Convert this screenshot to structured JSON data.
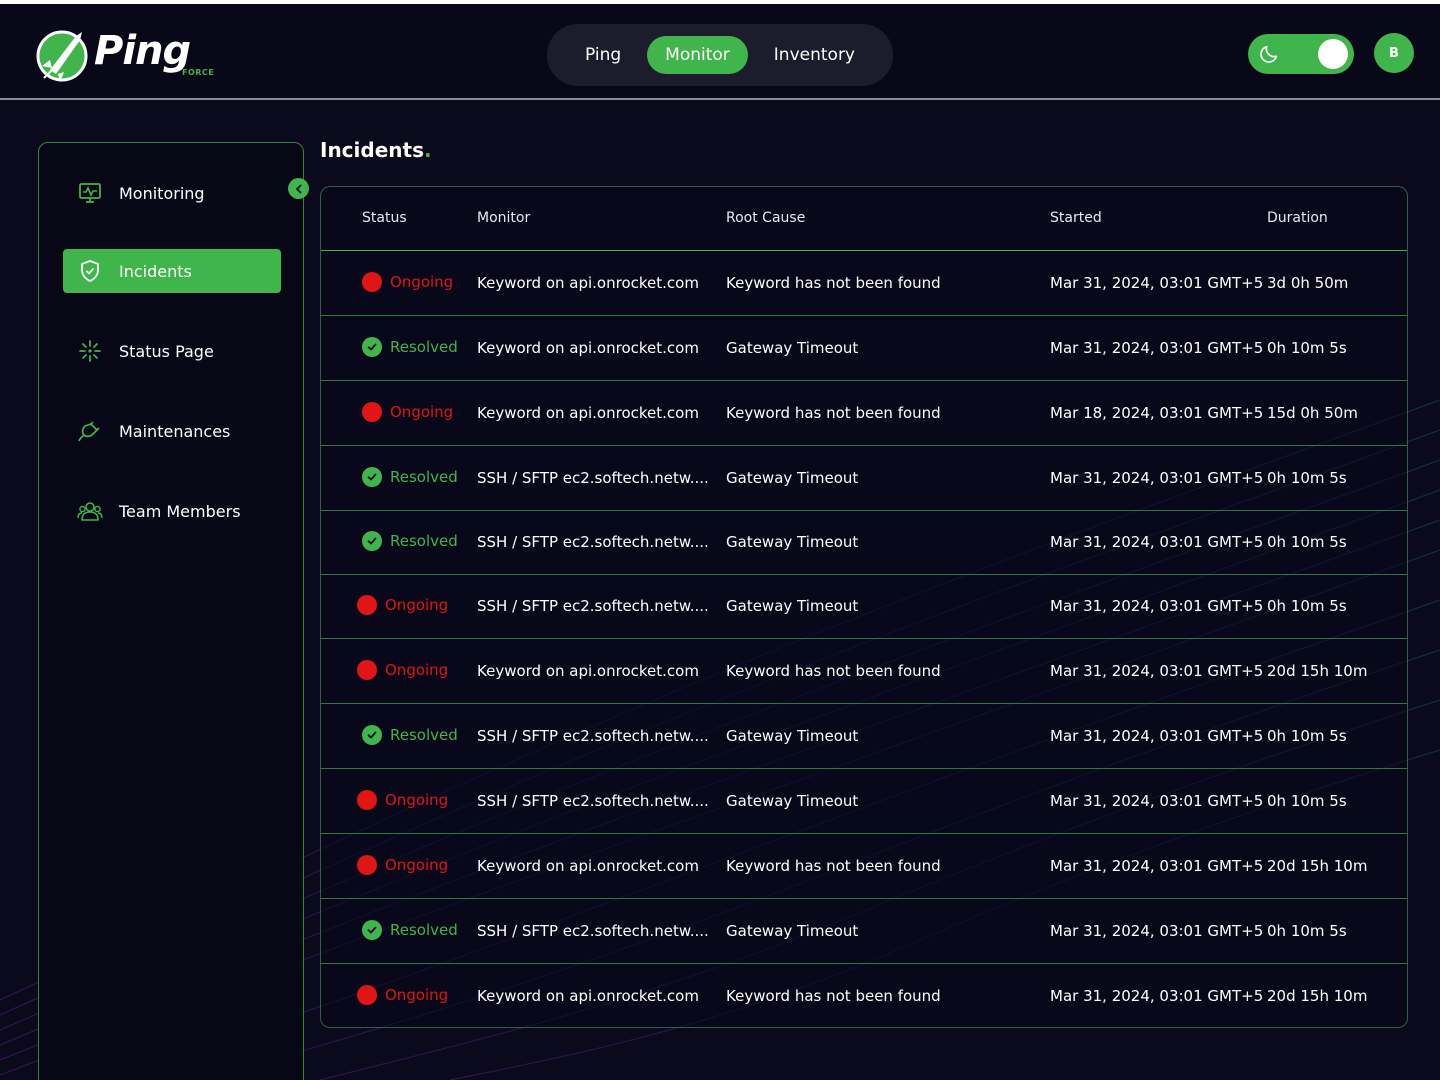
{
  "brand": {
    "name": "Ping",
    "sub": "FORCE"
  },
  "nav": {
    "items": [
      "Ping",
      "Monitor",
      "Inventory"
    ],
    "active": "Monitor"
  },
  "theme_toggle": {
    "icon": "moon-icon",
    "state": "dark"
  },
  "avatar": {
    "initial": "B"
  },
  "sidebar": {
    "items": [
      {
        "label": "Monitoring",
        "icon": "monitor-icon"
      },
      {
        "label": "Incidents",
        "icon": "shield-icon",
        "active": true
      },
      {
        "label": "Status Page",
        "icon": "sparkle-icon"
      },
      {
        "label": "Maintenances",
        "icon": "plug-icon"
      },
      {
        "label": "Team Members",
        "icon": "team-icon"
      }
    ]
  },
  "colors": {
    "accent": "#3fb54b",
    "danger": "#e01515",
    "background": "#0a0a1c"
  },
  "page": {
    "title": "Incidents",
    "title_dot": "."
  },
  "table": {
    "headers": [
      "Status",
      "Monitor",
      "Root Cause",
      "Started",
      "Duration"
    ],
    "rows": [
      {
        "status": "Ongoing",
        "monitor": "Keyword on api.onrocket.com",
        "root_cause": "Keyword has not been found",
        "started": "Mar 31, 2024, 03:01 GMT+5",
        "duration": "3d 0h 50m"
      },
      {
        "status": "Resolved",
        "monitor": "Keyword on api.onrocket.com",
        "root_cause": "Gateway Timeout",
        "started": "Mar 31, 2024, 03:01 GMT+5",
        "duration": "0h 10m 5s"
      },
      {
        "status": "Ongoing",
        "monitor": "Keyword on api.onrocket.com",
        "root_cause": "Keyword has not been found",
        "started": "Mar 18, 2024, 03:01 GMT+5",
        "duration": "15d 0h 50m"
      },
      {
        "status": "Resolved",
        "monitor": "SSH / SFTP ec2.softech.netw....",
        "root_cause": "Gateway Timeout",
        "started": "Mar 31, 2024, 03:01 GMT+5",
        "duration": "0h 10m 5s"
      },
      {
        "status": "Resolved",
        "monitor": "SSH / SFTP ec2.softech.netw....",
        "root_cause": "Gateway Timeout",
        "started": "Mar 31, 2024, 03:01 GMT+5",
        "duration": "0h 10m 5s"
      },
      {
        "status": "Ongoing",
        "monitor": "SSH / SFTP ec2.softech.netw....",
        "root_cause": "Gateway Timeout",
        "started": "Mar 31, 2024, 03:01 GMT+5",
        "duration": "0h 10m 5s"
      },
      {
        "status": "Ongoing",
        "monitor": "Keyword on api.onrocket.com",
        "root_cause": "Keyword has not been found",
        "started": "Mar 31, 2024, 03:01 GMT+5",
        "duration": "20d 15h 10m"
      },
      {
        "status": "Resolved",
        "monitor": "SSH / SFTP ec2.softech.netw....",
        "root_cause": "Gateway Timeout",
        "started": "Mar 31, 2024, 03:01 GMT+5",
        "duration": "0h 10m 5s"
      },
      {
        "status": "Ongoing",
        "monitor": "SSH / SFTP ec2.softech.netw....",
        "root_cause": "Gateway Timeout",
        "started": "Mar 31, 2024, 03:01 GMT+5",
        "duration": "0h 10m 5s"
      },
      {
        "status": "Ongoing",
        "monitor": "Keyword on api.onrocket.com",
        "root_cause": "Keyword has not been found",
        "started": "Mar 31, 2024, 03:01 GMT+5",
        "duration": "20d 15h 10m"
      },
      {
        "status": "Resolved",
        "monitor": "SSH / SFTP ec2.softech.netw....",
        "root_cause": "Gateway Timeout",
        "started": "Mar 31, 2024, 03:01 GMT+5",
        "duration": "0h 10m 5s"
      },
      {
        "status": "Ongoing",
        "monitor": "Keyword on api.onrocket.com",
        "root_cause": "Keyword has not been found",
        "started": "Mar 31, 2024, 03:01 GMT+5",
        "duration": "20d 15h 10m"
      }
    ]
  }
}
